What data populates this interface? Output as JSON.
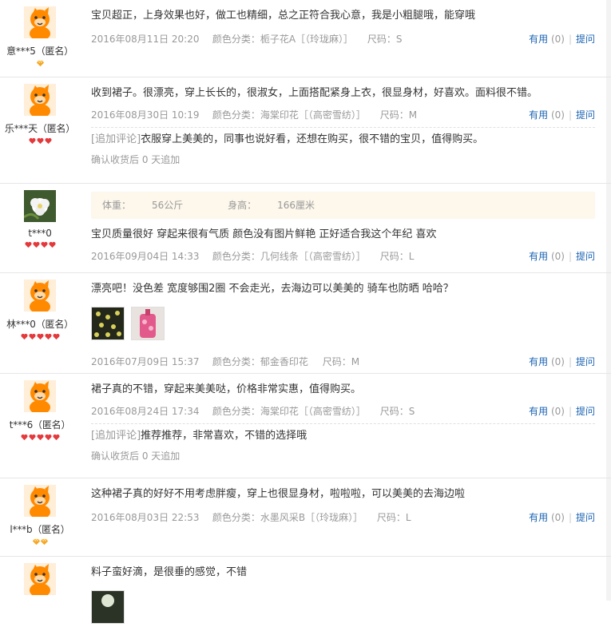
{
  "reviews": [
    {
      "user": "意***5（匿名）",
      "badge_type": "diamond",
      "badge_count": 1,
      "content": "宝贝超正，上身效果也好，做工也精细，总之正符合我心意，我是小粗腿哦，能穿哦",
      "date": "2016年08月11日 20:20",
      "color_label": "颜色分类：",
      "color_value": "栀子花A［（玲珑麻）］",
      "size_label": "尺码：",
      "size_value": "S",
      "useful_label": "有用",
      "useful_count": "(0)",
      "ask_label": "提问"
    },
    {
      "user": "乐***天（匿名）",
      "badge_type": "heart",
      "badge_count": 3,
      "content": "收到裙子。很漂亮，穿上长长的，很淑女，上面搭配紧身上衣，很显身材，好喜欢。面料很不错。",
      "date": "2016年08月30日 10:19",
      "color_label": "颜色分类：",
      "color_value": "海棠印花［（高密雪纺）］",
      "size_label": "尺码：",
      "size_value": "M",
      "useful_label": "有用",
      "useful_count": "(0)",
      "ask_label": "提问",
      "append_tag": "[追加评论]",
      "append_text": "衣服穿上美美的，同事也说好看，还想在购买，很不错的宝贝，值得购买。",
      "confirm_text": "确认收货后 0 天追加"
    },
    {
      "user": "t***0",
      "badge_type": "heart",
      "badge_count": 4,
      "weight_label": "体重：",
      "weight_value": "56公斤",
      "height_label": "身高：",
      "height_value": "166厘米",
      "content": "宝贝质量很好 穿起来很有气质 颜色没有图片鲜艳 正好适合我这个年纪 喜欢",
      "date": "2016年09月04日 14:33",
      "color_label": "颜色分类：",
      "color_value": "几何线条［（高密雪纺）］",
      "size_label": "尺码：",
      "size_value": "L",
      "useful_label": "有用",
      "useful_count": "(0)",
      "ask_label": "提问"
    },
    {
      "user": "林***0（匿名）",
      "badge_type": "heart",
      "badge_count": 5,
      "content": "漂亮吧！没色差 宽度够围2圈 不会走光，去海边可以美美的 骑车也防晒 哈哈？",
      "date": "2016年07月09日 15:37",
      "color_label": "颜色分类：",
      "color_value": "郁金香印花",
      "size_label": "尺码：",
      "size_value": "M",
      "useful_label": "有用",
      "useful_count": "(0)",
      "ask_label": "提问"
    },
    {
      "user": "t***6（匿名）",
      "badge_type": "heart",
      "badge_count": 5,
      "content": "裙子真的不错，穿起来美美哒，价格非常实惠，值得购买。",
      "date": "2016年08月24日 17:34",
      "color_label": "颜色分类：",
      "color_value": "海棠印花［（高密雪纺）］",
      "size_label": "尺码：",
      "size_value": "S",
      "useful_label": "有用",
      "useful_count": "(0)",
      "ask_label": "提问",
      "append_tag": "[追加评论]",
      "append_text": "推荐推荐，非常喜欢，不错的选择哦",
      "confirm_text": "确认收货后 0 天追加"
    },
    {
      "user": "l***b（匿名）",
      "badge_type": "diamond",
      "badge_count": 2,
      "content": "这种裙子真的好好不用考虑胖瘦，穿上也很显身材，啦啦啦，可以美美的去海边啦",
      "date": "2016年08月03日 22:53",
      "color_label": "颜色分类：",
      "color_value": "水墨风采B［（玲珑麻）］",
      "size_label": "尺码：",
      "size_value": "L",
      "useful_label": "有用",
      "useful_count": "(0)",
      "ask_label": "提问"
    },
    {
      "content": "料子蛮好滴，是很垂的感觉，不错"
    }
  ],
  "colors": {
    "link": "#1b64b3",
    "muted": "#999999",
    "heart": "#e4393c",
    "diamond": "#f5a623",
    "avatar": "#ff8a00"
  }
}
